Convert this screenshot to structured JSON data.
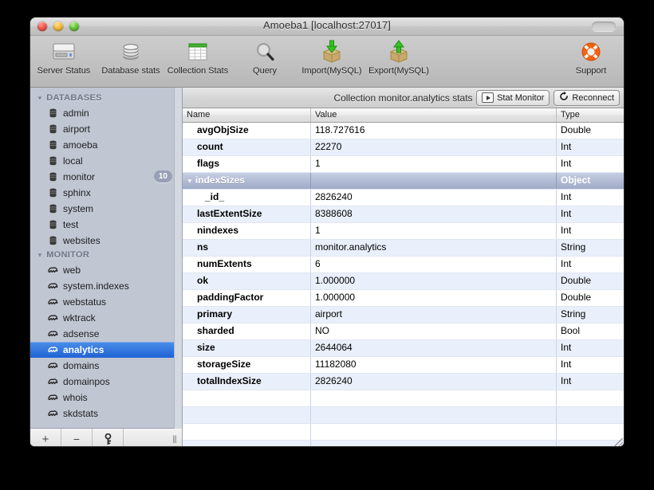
{
  "window": {
    "title": "Amoeba1 [localhost:27017]",
    "traffic": [
      "close-button",
      "minimize-button",
      "zoom-button"
    ]
  },
  "toolbar": {
    "items": [
      {
        "label": "Server Status",
        "icon": "server-icon"
      },
      {
        "label": "Database stats",
        "icon": "database-icon"
      },
      {
        "label": "Collection Stats",
        "icon": "table-grid-icon"
      },
      {
        "label": "Query",
        "icon": "magnifier-icon"
      },
      {
        "label": "Import(MySQL)",
        "icon": "import-box-icon"
      },
      {
        "label": "Export(MySQL)",
        "icon": "export-box-icon"
      }
    ],
    "support": {
      "label": "Support",
      "icon": "lifering-icon"
    }
  },
  "sidebar": {
    "groups": [
      {
        "title": "DATABASES",
        "items": [
          {
            "label": "admin",
            "icon": "database-icon",
            "badge": "",
            "selected": false
          },
          {
            "label": "airport",
            "icon": "database-icon",
            "badge": "",
            "selected": false
          },
          {
            "label": "amoeba",
            "icon": "database-icon",
            "badge": "",
            "selected": false
          },
          {
            "label": "local",
            "icon": "database-icon",
            "badge": "",
            "selected": false
          },
          {
            "label": "monitor",
            "icon": "database-icon",
            "badge": "10",
            "selected": false
          },
          {
            "label": "sphinx",
            "icon": "database-icon",
            "badge": "",
            "selected": false
          },
          {
            "label": "system",
            "icon": "database-icon",
            "badge": "",
            "selected": false
          },
          {
            "label": "test",
            "icon": "database-icon",
            "badge": "",
            "selected": false
          },
          {
            "label": "websites",
            "icon": "database-icon",
            "badge": "",
            "selected": false
          }
        ]
      },
      {
        "title": "MONITOR",
        "items": [
          {
            "label": "web",
            "icon": "collection-icon",
            "badge": "",
            "selected": false
          },
          {
            "label": "system.indexes",
            "icon": "collection-icon",
            "badge": "",
            "selected": false
          },
          {
            "label": "webstatus",
            "icon": "collection-icon",
            "badge": "",
            "selected": false
          },
          {
            "label": "wktrack",
            "icon": "collection-icon",
            "badge": "",
            "selected": false
          },
          {
            "label": "adsense",
            "icon": "collection-icon",
            "badge": "",
            "selected": false
          },
          {
            "label": "analytics",
            "icon": "collection-icon",
            "badge": "",
            "selected": true
          },
          {
            "label": "domains",
            "icon": "collection-icon",
            "badge": "",
            "selected": false
          },
          {
            "label": "domainpos",
            "icon": "collection-icon",
            "badge": "",
            "selected": false
          },
          {
            "label": "whois",
            "icon": "collection-icon",
            "badge": "",
            "selected": false
          },
          {
            "label": "skdstats",
            "icon": "collection-icon",
            "badge": "",
            "selected": false
          }
        ]
      }
    ],
    "bottombar": {
      "add_label": "+",
      "remove_label": "−",
      "key_icon": "key-icon",
      "grip_label": "|||"
    }
  },
  "main": {
    "header": {
      "title": "Collection monitor.analytics stats",
      "stat_monitor_label": "Stat Monitor",
      "reconnect_label": "Reconnect",
      "reconnect_icon": "refresh-icon",
      "stat_monitor_icon": "play-icon"
    },
    "table": {
      "columns": [
        "Name",
        "Value",
        "Type"
      ],
      "rows": [
        {
          "name": "avgObjSize",
          "value": "118.727616",
          "type": "Double",
          "kind": "leaf",
          "indent": 1
        },
        {
          "name": "count",
          "value": "22270",
          "type": "Int",
          "kind": "leaf",
          "indent": 1
        },
        {
          "name": "flags",
          "value": "1",
          "type": "Int",
          "kind": "leaf",
          "indent": 1
        },
        {
          "name": "indexSizes",
          "value": "",
          "type": "Object",
          "kind": "group",
          "indent": 0
        },
        {
          "name": "_id_",
          "value": "2826240",
          "type": "Int",
          "kind": "leaf",
          "indent": 2
        },
        {
          "name": "lastExtentSize",
          "value": "8388608",
          "type": "Int",
          "kind": "leaf",
          "indent": 1
        },
        {
          "name": "nindexes",
          "value": "1",
          "type": "Int",
          "kind": "leaf",
          "indent": 1
        },
        {
          "name": "ns",
          "value": "monitor.analytics",
          "type": "String",
          "kind": "leaf",
          "indent": 1
        },
        {
          "name": "numExtents",
          "value": "6",
          "type": "Int",
          "kind": "leaf",
          "indent": 1
        },
        {
          "name": "ok",
          "value": "1.000000",
          "type": "Double",
          "kind": "leaf",
          "indent": 1
        },
        {
          "name": "paddingFactor",
          "value": "1.000000",
          "type": "Double",
          "kind": "leaf",
          "indent": 1
        },
        {
          "name": "primary",
          "value": "airport",
          "type": "String",
          "kind": "leaf",
          "indent": 1
        },
        {
          "name": "sharded",
          "value": "NO",
          "type": "Bool",
          "kind": "leaf",
          "indent": 1
        },
        {
          "name": "size",
          "value": "2644064",
          "type": "Int",
          "kind": "leaf",
          "indent": 1
        },
        {
          "name": "storageSize",
          "value": "11182080",
          "type": "Int",
          "kind": "leaf",
          "indent": 1
        },
        {
          "name": "totalIndexSize",
          "value": "2826240",
          "type": "Int",
          "kind": "leaf",
          "indent": 1
        }
      ],
      "empty_rows": 5
    }
  },
  "colors": {
    "selection": "#1f63d6",
    "object_row": "#9fabc7",
    "alt_row": "#eaf0fb",
    "sidebar_bg": "#c0c6d2"
  }
}
